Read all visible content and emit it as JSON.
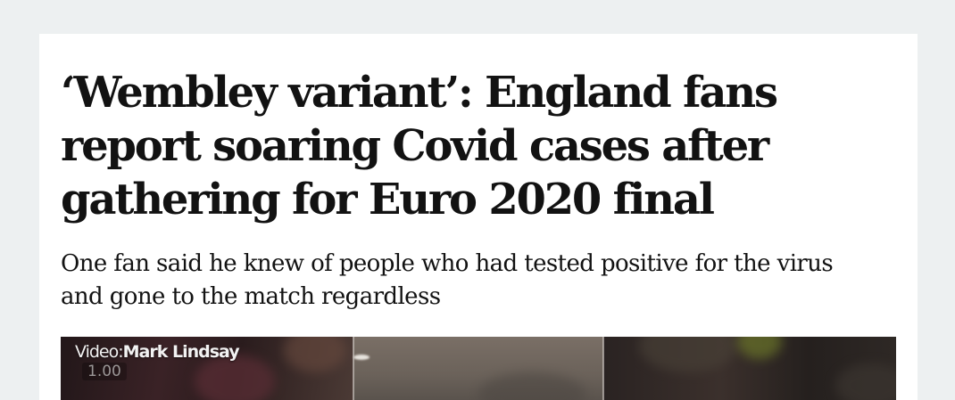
{
  "article": {
    "headline_lines": [
      "‘Wembley variant’: England fans",
      "report soaring Covid cases after",
      "gathering for Euro 2020 final"
    ],
    "standfirst_lines": [
      "One fan said he knew of people who had tested positive for the virus",
      "and gone to the match regardless"
    ]
  },
  "video": {
    "credit_prefix": "Video:",
    "credit_name": "Mark Lindsay",
    "playback_rate": "1.00"
  },
  "colors": {
    "page_background": "#edf0f1",
    "card_background": "#ffffff",
    "text": "#121212"
  }
}
